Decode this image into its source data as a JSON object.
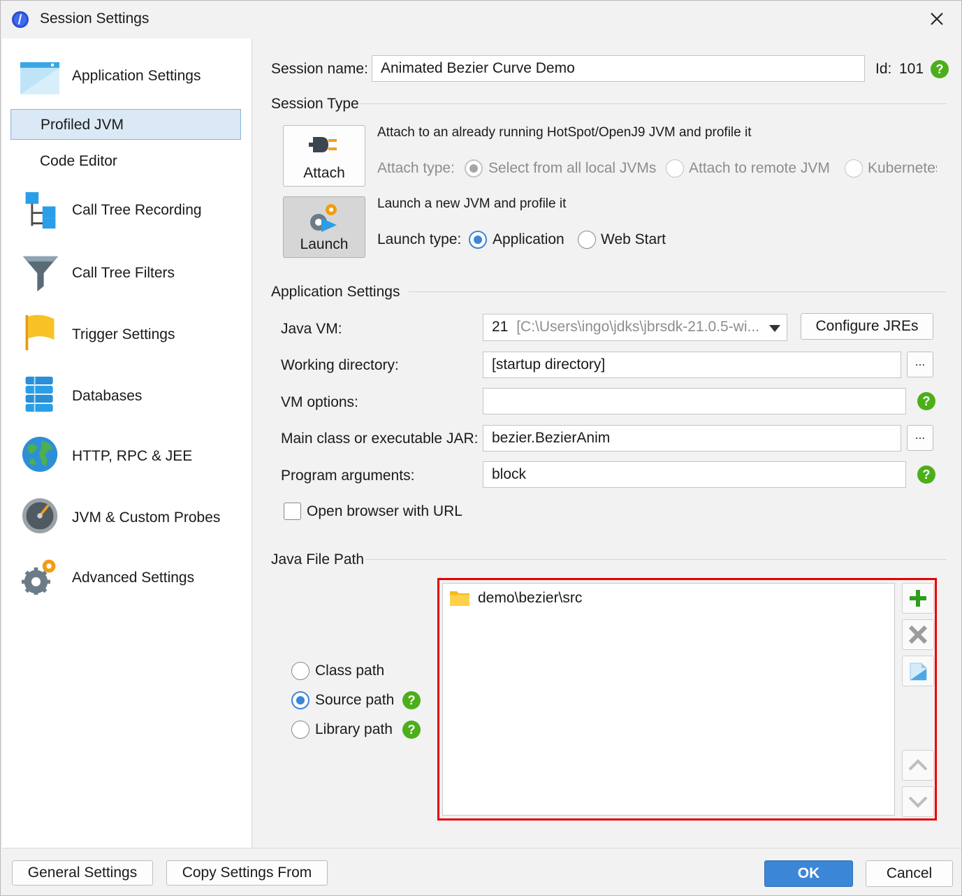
{
  "window": {
    "title": "Session Settings"
  },
  "sidebar": {
    "items": [
      {
        "label": "Application Settings"
      },
      {
        "label": "Profiled JVM"
      },
      {
        "label": "Code Editor"
      },
      {
        "label": "Call Tree Recording"
      },
      {
        "label": "Call Tree Filters"
      },
      {
        "label": "Trigger Settings"
      },
      {
        "label": "Databases"
      },
      {
        "label": "HTTP, RPC & JEE"
      },
      {
        "label": "JVM & Custom Probes"
      },
      {
        "label": "Advanced Settings"
      }
    ]
  },
  "session": {
    "name_label": "Session name:",
    "name_value": "Animated Bezier Curve Demo",
    "id_label": "Id:",
    "id_value": "101"
  },
  "session_type": {
    "heading": "Session Type",
    "attach_button": "Attach",
    "launch_button": "Launch",
    "attach_desc": "Attach to an already running HotSpot/OpenJ9 JVM and profile it",
    "attach_type_label": "Attach type:",
    "attach_options": [
      "Select from all local JVMs",
      "Attach to remote JVM",
      "Kubernetes"
    ],
    "launch_desc": "Launch a new JVM and profile it",
    "launch_type_label": "Launch type:",
    "launch_options": [
      "Application",
      "Web Start"
    ]
  },
  "app_settings": {
    "heading": "Application Settings",
    "java_vm_label": "Java VM:",
    "java_vm_version": "21",
    "java_vm_path": "[C:\\Users\\ingo\\jdks\\jbrsdk-21.0.5-wi...",
    "configure_jres": "Configure JREs",
    "working_dir_label": "Working directory:",
    "working_dir_value": "[startup directory]",
    "vm_options_label": "VM options:",
    "vm_options_value": "",
    "main_class_label": "Main class or executable JAR:",
    "main_class_value": "bezier.BezierAnim",
    "program_args_label": "Program arguments:",
    "program_args_value": "block",
    "browse_label": "...",
    "open_browser_label": "Open browser with URL"
  },
  "java_file_path": {
    "heading": "Java File Path",
    "options": [
      "Class path",
      "Source path",
      "Library path"
    ],
    "entries": [
      "demo\\bezier\\src"
    ]
  },
  "footer": {
    "general_settings": "General Settings",
    "copy_settings": "Copy Settings From",
    "ok": "OK",
    "cancel": "Cancel"
  },
  "colors": {
    "accent": "#3b86d6",
    "help_green": "#4caf1a",
    "highlight_red": "#e60000",
    "selection_bg": "#dbe8f6"
  }
}
